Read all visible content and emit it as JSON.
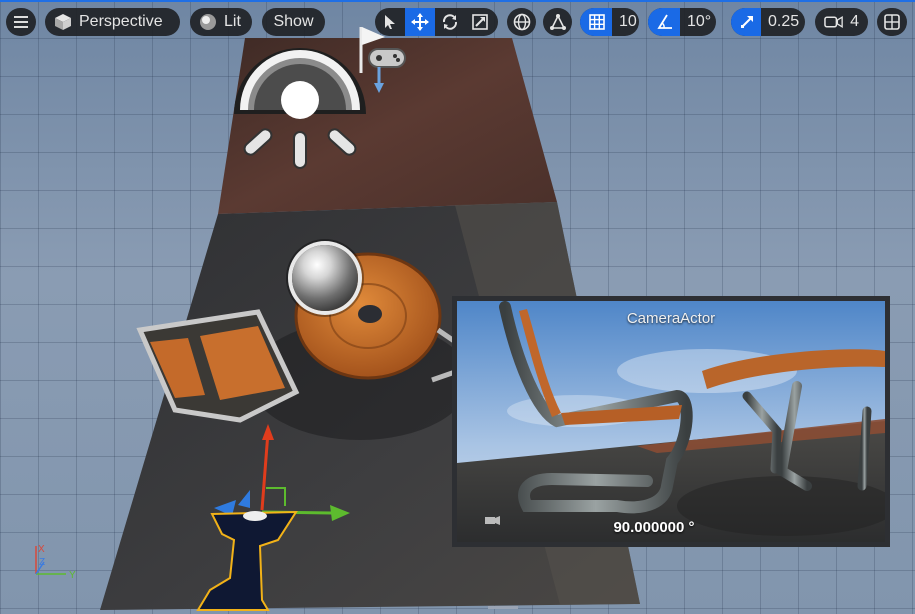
{
  "toolbar": {
    "menu_icon": "hamburger-menu-icon",
    "perspective_label": "Perspective",
    "lit_label": "Lit",
    "show_label": "Show",
    "grid_snap_value": "10",
    "rotation_snap_value": "10°",
    "scale_snap_value": "0.25",
    "camera_speed_value": "4",
    "accent_color": "#1a6ae6"
  },
  "preview": {
    "title": "CameraActor",
    "angle": "90.000000 °"
  },
  "axis": {
    "x": "X",
    "y": "Y",
    "z": "Z"
  }
}
